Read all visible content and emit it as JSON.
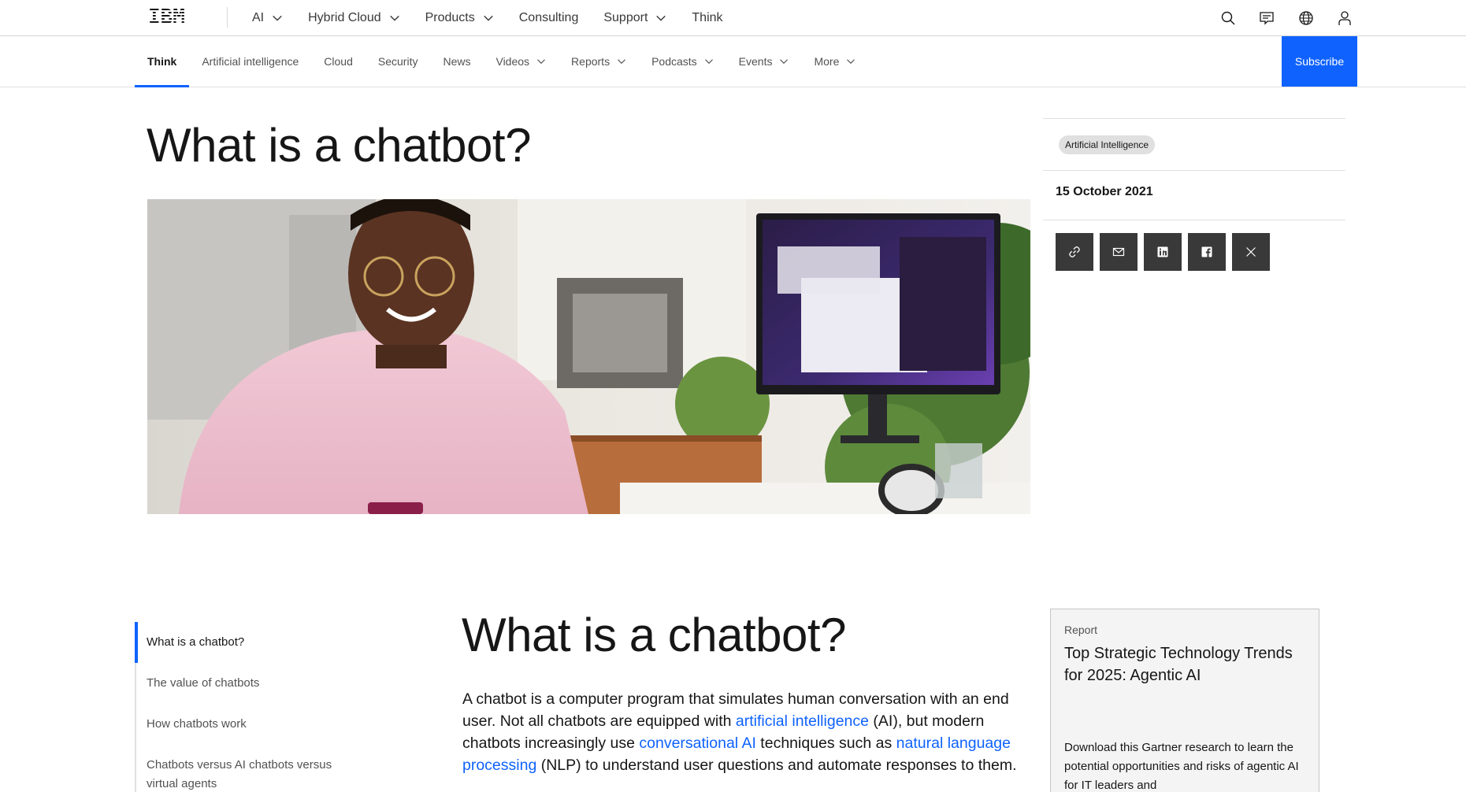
{
  "masthead": {
    "logo": "IBM",
    "nav": [
      {
        "label": "AI",
        "has_menu": true
      },
      {
        "label": "Hybrid Cloud",
        "has_menu": true
      },
      {
        "label": "Products",
        "has_menu": true
      },
      {
        "label": "Consulting",
        "has_menu": false
      },
      {
        "label": "Support",
        "has_menu": true
      },
      {
        "label": "Think",
        "has_menu": false
      }
    ],
    "utilities": [
      "search-icon",
      "chat-icon",
      "globe-icon",
      "user-icon"
    ]
  },
  "subnav": {
    "items": [
      {
        "label": "Think",
        "active": true,
        "has_menu": false
      },
      {
        "label": "Artificial intelligence",
        "has_menu": false
      },
      {
        "label": "Cloud",
        "has_menu": false
      },
      {
        "label": "Security",
        "has_menu": false
      },
      {
        "label": "News",
        "has_menu": false
      },
      {
        "label": "Videos",
        "has_menu": true
      },
      {
        "label": "Reports",
        "has_menu": true
      },
      {
        "label": "Podcasts",
        "has_menu": true
      },
      {
        "label": "Events",
        "has_menu": true
      },
      {
        "label": "More",
        "has_menu": true
      }
    ],
    "subscribe_label": "Subscribe"
  },
  "hero": {
    "title": "What is a chatbot?",
    "image_icon": "hero-photo"
  },
  "meta": {
    "tag": "Artificial Intelligence",
    "date": "15 October 2021",
    "share": [
      "link-icon",
      "email-icon",
      "linkedin-icon",
      "facebook-icon",
      "x-icon"
    ]
  },
  "toc": {
    "items": [
      {
        "label": "What is a chatbot?",
        "active": true
      },
      {
        "label": "The value of chatbots"
      },
      {
        "label": "How chatbots work"
      },
      {
        "label": "Chatbots versus AI chatbots versus virtual agents"
      }
    ]
  },
  "article": {
    "heading": "What is a chatbot?",
    "p1": "A chatbot is a computer program that simulates human conversation with an end user. Not all chatbots are equipped with ",
    "link1": "artificial intelligence",
    "p2": " (AI), but modern chatbots increasingly use ",
    "link2": "conversational AI",
    "p3": " techniques such as ",
    "link3": "natural language processing",
    "p4": " (NLP) to understand user questions and automate responses to them."
  },
  "report": {
    "kicker": "Report",
    "title": "Top Strategic Technology Trends for 2025: Agentic AI",
    "desc": "Download this Gartner research to learn the potential opportunities and risks of agentic AI for IT leaders and"
  },
  "colors": {
    "accent": "#0f62fe",
    "share_bg": "#393939",
    "tag_bg": "#e0e0e0"
  }
}
